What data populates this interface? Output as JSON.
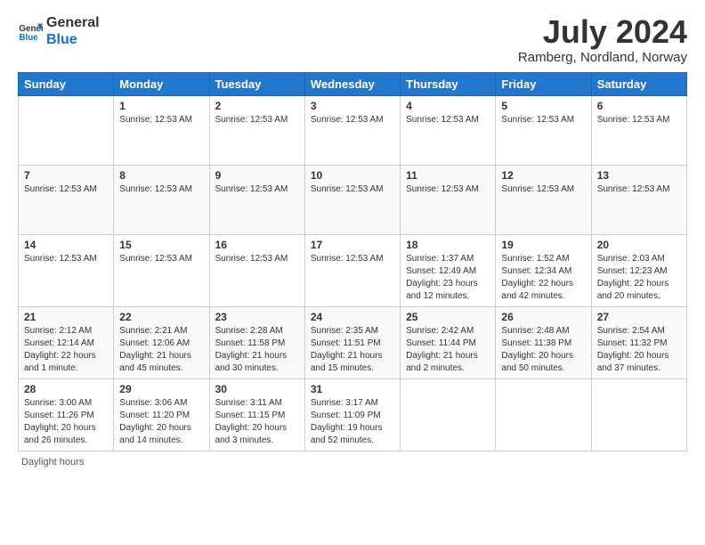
{
  "logo": {
    "line1": "General",
    "line2": "Blue"
  },
  "title": "July 2024",
  "subtitle": "Ramberg, Nordland, Norway",
  "days_of_week": [
    "Sunday",
    "Monday",
    "Tuesday",
    "Wednesday",
    "Thursday",
    "Friday",
    "Saturday"
  ],
  "weeks": [
    [
      {
        "num": "",
        "info": ""
      },
      {
        "num": "1",
        "info": "Sunrise: 12:53 AM"
      },
      {
        "num": "2",
        "info": "Sunrise: 12:53 AM"
      },
      {
        "num": "3",
        "info": "Sunrise: 12:53 AM"
      },
      {
        "num": "4",
        "info": "Sunrise: 12:53 AM"
      },
      {
        "num": "5",
        "info": "Sunrise: 12:53 AM"
      },
      {
        "num": "6",
        "info": "Sunrise: 12:53 AM"
      }
    ],
    [
      {
        "num": "7",
        "info": "Sunrise: 12:53 AM"
      },
      {
        "num": "8",
        "info": "Sunrise: 12:53 AM"
      },
      {
        "num": "9",
        "info": "Sunrise: 12:53 AM"
      },
      {
        "num": "10",
        "info": "Sunrise: 12:53 AM"
      },
      {
        "num": "11",
        "info": "Sunrise: 12:53 AM"
      },
      {
        "num": "12",
        "info": "Sunrise: 12:53 AM"
      },
      {
        "num": "13",
        "info": "Sunrise: 12:53 AM"
      }
    ],
    [
      {
        "num": "14",
        "info": "Sunrise: 12:53 AM"
      },
      {
        "num": "15",
        "info": "Sunrise: 12:53 AM"
      },
      {
        "num": "16",
        "info": "Sunrise: 12:53 AM"
      },
      {
        "num": "17",
        "info": "Sunrise: 12:53 AM"
      },
      {
        "num": "18",
        "info": "Sunrise: 1:37 AM\nSunset: 12:49 AM\nDaylight: 23 hours and 12 minutes."
      },
      {
        "num": "19",
        "info": "Sunrise: 1:52 AM\nSunset: 12:34 AM\nDaylight: 22 hours and 42 minutes."
      },
      {
        "num": "20",
        "info": "Sunrise: 2:03 AM\nSunset: 12:23 AM\nDaylight: 22 hours and 20 minutes."
      }
    ],
    [
      {
        "num": "21",
        "info": "Sunrise: 2:12 AM\nSunset: 12:14 AM\nDaylight: 22 hours and 1 minute."
      },
      {
        "num": "22",
        "info": "Sunrise: 2:21 AM\nSunset: 12:06 AM\nDaylight: 21 hours and 45 minutes."
      },
      {
        "num": "23",
        "info": "Sunrise: 2:28 AM\nSunset: 11:58 PM\nDaylight: 21 hours and 30 minutes."
      },
      {
        "num": "24",
        "info": "Sunrise: 2:35 AM\nSunset: 11:51 PM\nDaylight: 21 hours and 15 minutes."
      },
      {
        "num": "25",
        "info": "Sunrise: 2:42 AM\nSunset: 11:44 PM\nDaylight: 21 hours and 2 minutes."
      },
      {
        "num": "26",
        "info": "Sunrise: 2:48 AM\nSunset: 11:38 PM\nDaylight: 20 hours and 50 minutes."
      },
      {
        "num": "27",
        "info": "Sunrise: 2:54 AM\nSunset: 11:32 PM\nDaylight: 20 hours and 37 minutes."
      }
    ],
    [
      {
        "num": "28",
        "info": "Sunrise: 3:00 AM\nSunset: 11:26 PM\nDaylight: 20 hours and 26 minutes."
      },
      {
        "num": "29",
        "info": "Sunrise: 3:06 AM\nSunset: 11:20 PM\nDaylight: 20 hours and 14 minutes."
      },
      {
        "num": "30",
        "info": "Sunrise: 3:11 AM\nSunset: 11:15 PM\nDaylight: 20 hours and 3 minutes."
      },
      {
        "num": "31",
        "info": "Sunrise: 3:17 AM\nSunset: 11:09 PM\nDaylight: 19 hours and 52 minutes."
      },
      {
        "num": "",
        "info": ""
      },
      {
        "num": "",
        "info": ""
      },
      {
        "num": "",
        "info": ""
      }
    ]
  ],
  "footer": "Daylight hours"
}
